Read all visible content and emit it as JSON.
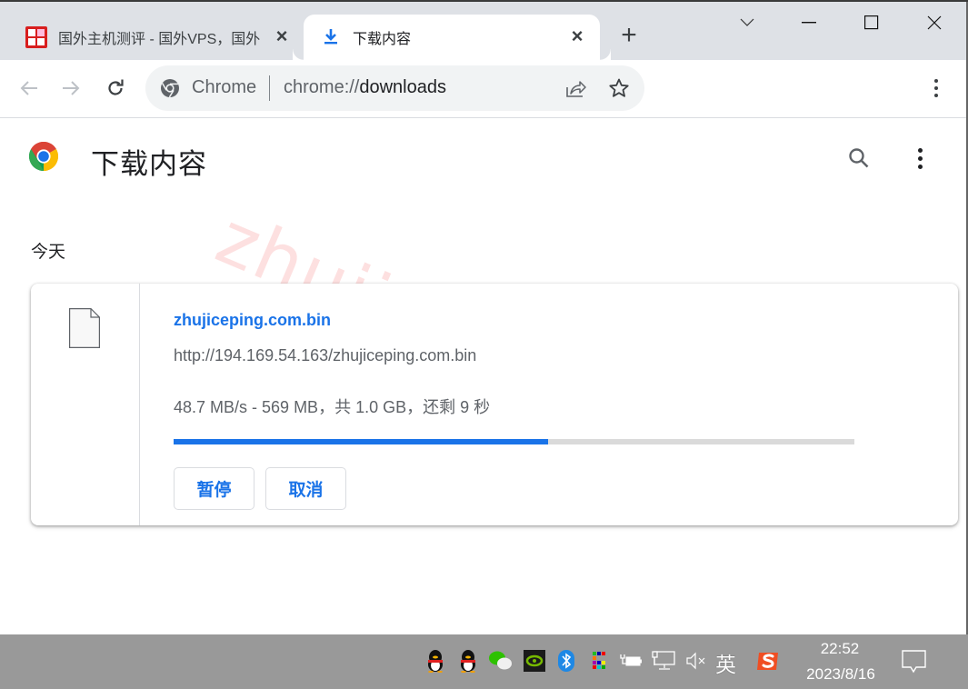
{
  "browser": {
    "tabs": [
      {
        "title": "国外主机测评 - 国外VPS，国外",
        "favicon": "site-seal-icon",
        "active": false
      },
      {
        "title": "下载内容",
        "favicon": "download-icon",
        "active": true
      }
    ],
    "new_tab_label": "+",
    "window_controls": [
      "tab-search",
      "minimize",
      "maximize",
      "close"
    ],
    "omnibox": {
      "origin_label": "Chrome",
      "url_prefix": "chrome://",
      "url_host": "downloads"
    }
  },
  "page": {
    "title": "下载内容",
    "section_date": "今天",
    "watermark": "zhujiceping.com"
  },
  "downloads": [
    {
      "file_name": "zhujiceping.com.bin",
      "url": "http://194.169.54.163/zhujiceping.com.bin",
      "status": "48.7 MB/s - 569 MB，共 1.0 GB，还剩 9 秒",
      "progress_fraction": 0.55,
      "actions": {
        "pause": "暂停",
        "cancel": "取消"
      }
    }
  ],
  "taskbar": {
    "tray_icons": [
      "qq-icon",
      "qq-icon",
      "wechat-icon",
      "nvidia-icon",
      "bluetooth-icon",
      "color-app-icon",
      "power-icon",
      "network-icon",
      "volume-muted-icon",
      "sogou-icon"
    ],
    "ime_label": "英",
    "time": "22:52",
    "date": "2023/8/16"
  },
  "colors": {
    "accent": "#1a73e8",
    "tabstrip": "#dee1e6",
    "taskbar": "#999999"
  }
}
